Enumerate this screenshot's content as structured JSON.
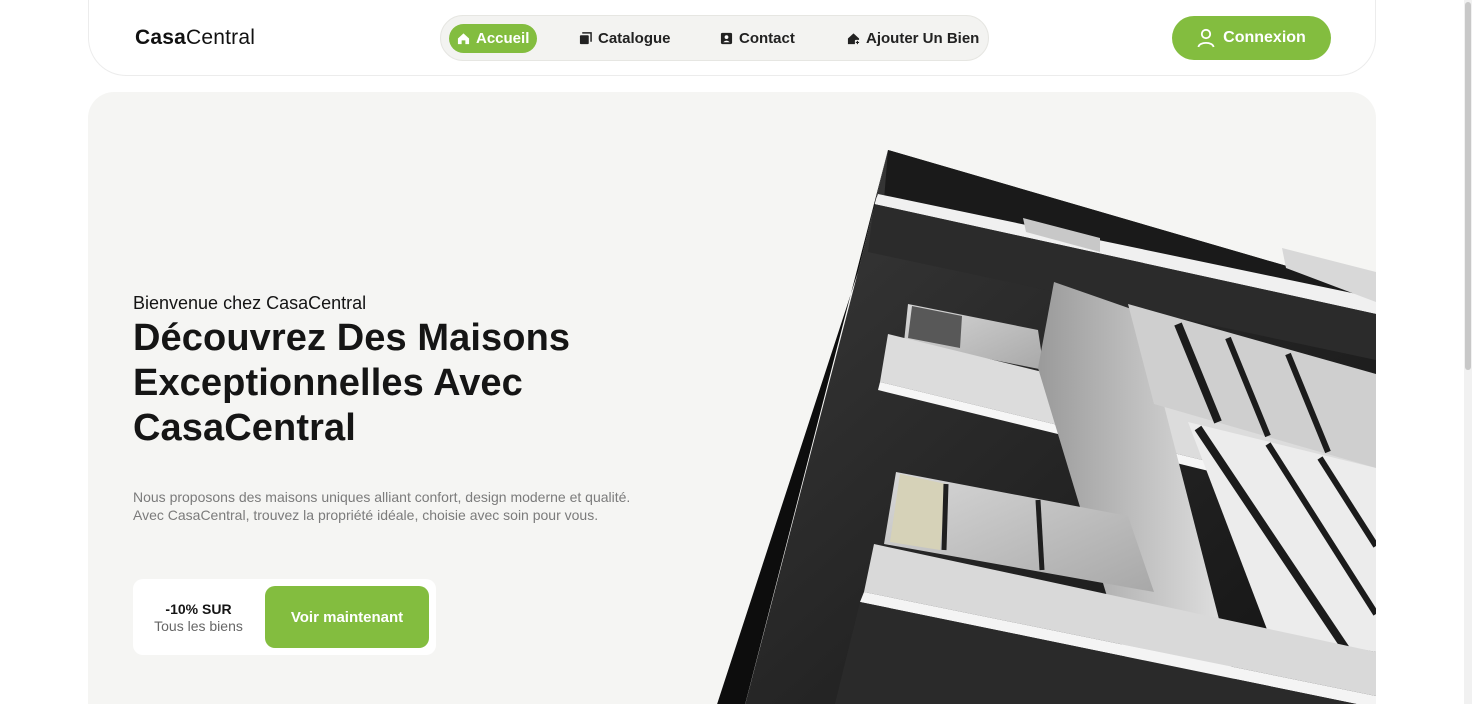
{
  "brand": {
    "bold": "Casa",
    "light": "Central"
  },
  "nav": {
    "items": [
      {
        "label": "Accueil",
        "icon": "home-icon",
        "active": true
      },
      {
        "label": "Catalogue",
        "icon": "catalogue-icon",
        "active": false
      },
      {
        "label": "Contact",
        "icon": "contact-icon",
        "active": false
      },
      {
        "label": "Ajouter Un Bien",
        "icon": "add-property-icon",
        "active": false
      }
    ],
    "login_label": "Connexion",
    "login_icon": "user-icon"
  },
  "hero": {
    "eyebrow": "Bienvenue chez CasaCentral",
    "headline": "Découvrez Des Maisons Exceptionnelles Avec CasaCentral",
    "description": "Nous proposons des maisons uniques alliant confort, design moderne et qualité. Avec CasaCentral, trouvez la propriété idéale, choisie avec soin pour vous.",
    "promo_title": "-10% SUR",
    "promo_subtitle": "Tous les biens",
    "cta_label": "Voir maintenant",
    "image": "modern-building-photo"
  },
  "colors": {
    "accent": "#83bd3f",
    "hero_background": "#f5f5f3",
    "text_dark": "#151515",
    "text_muted": "#7b7b7b"
  }
}
